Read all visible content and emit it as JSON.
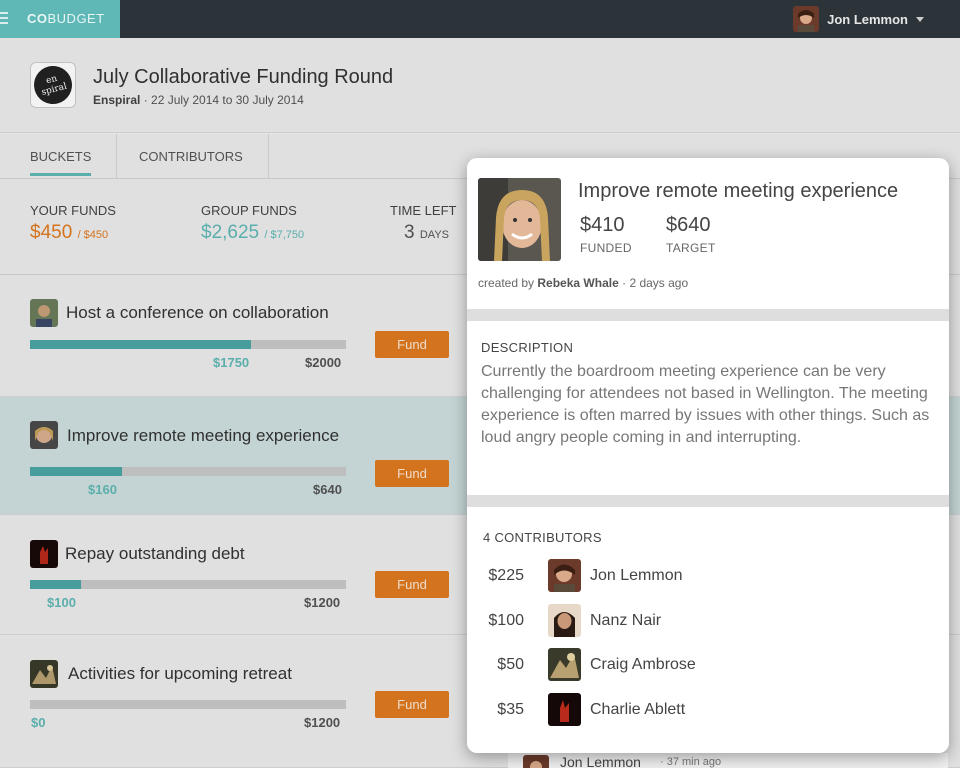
{
  "app": {
    "brand_bold": "CO",
    "brand_rest": "BUDGET"
  },
  "user": {
    "name": "Jon Lemmon"
  },
  "round": {
    "title": "July Collaborative Funding Round",
    "org": "Enspiral",
    "dates": "22 July 2014 to 30 July 2014",
    "logo_text": "en spiral"
  },
  "tabs": [
    {
      "label": "BUCKETS"
    },
    {
      "label": "CONTRIBUTORS"
    }
  ],
  "funds": {
    "your": {
      "label": "YOUR FUNDS",
      "value": "$450",
      "total": "/ $450"
    },
    "group": {
      "label": "GROUP FUNDS",
      "value": "$2,625",
      "total": "/ $7,750"
    },
    "time": {
      "label": "TIME LEFT",
      "value": "3",
      "unit": "DAYS"
    }
  },
  "buckets": [
    {
      "title": "Host a conference on collaboration",
      "funded": "$1750",
      "target": "$2000",
      "progress": 0.7,
      "button": "Fund"
    },
    {
      "title": "Improve remote meeting experience",
      "funded": "$160",
      "target": "$640",
      "progress": 0.29,
      "button": "Fund"
    },
    {
      "title": "Repay outstanding debt",
      "funded": "$100",
      "target": "$1200",
      "progress": 0.16,
      "button": "Fund"
    },
    {
      "title": "Activities for upcoming retreat",
      "funded": "$0",
      "target": "$1200",
      "progress": 0,
      "button": "Fund"
    }
  ],
  "detail": {
    "title": "Improve remote meeting experience",
    "funded": {
      "value": "$410",
      "label": "FUNDED"
    },
    "target": {
      "value": "$640",
      "label": "TARGET"
    },
    "created_prefix": "created by",
    "creator": "Rebeka Whale",
    "created_ago": "· 2 days ago",
    "description_label": "DESCRIPTION",
    "description": "Currently the boardroom meeting experience can be very challenging for attendees not based in Wellington.  The meeting experience is often marred by issues with other things. Such as loud angry people coming in and interrupting.",
    "contributors_label": "4 CONTRIBUTORS",
    "contributors": [
      {
        "amount": "$225",
        "name": "Jon Lemmon"
      },
      {
        "amount": "$100",
        "name": "Nanz Nair"
      },
      {
        "amount": "$50",
        "name": "Craig Ambrose"
      },
      {
        "amount": "$35",
        "name": "Charlie Ablett"
      }
    ]
  },
  "comment_peek": {
    "name": "Jon Lemmon",
    "time": "· 37 min ago"
  },
  "colors": {
    "teal": "#5fb8b6",
    "orange": "#e07a1f",
    "topbar": "#2c3439"
  }
}
